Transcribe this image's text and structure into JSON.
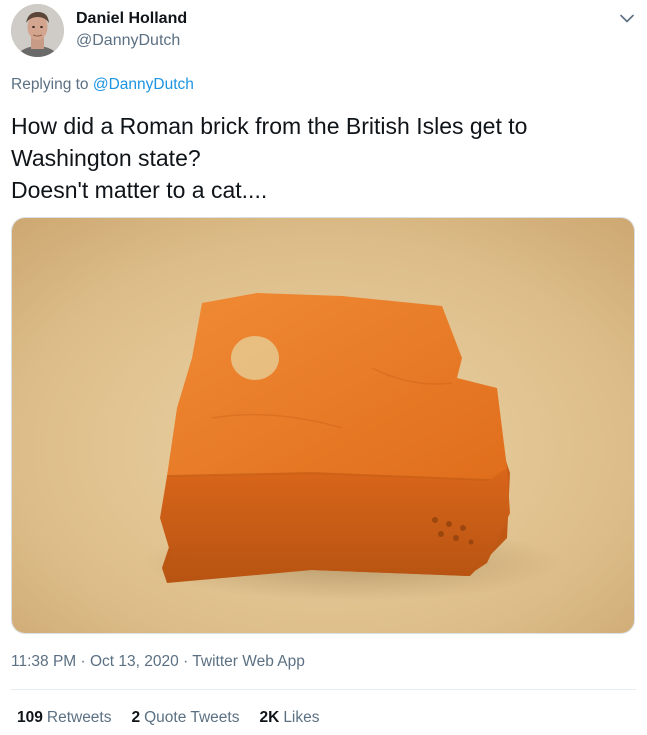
{
  "author": {
    "name": "Daniel Holland",
    "handle": "@DannyDutch"
  },
  "reply": {
    "prefix": "Replying to",
    "mention": "@DannyDutch"
  },
  "tweet": {
    "lines": [
      "How did a Roman brick from the British Isles get to",
      "Washington state?",
      "Doesn't matter to a cat...."
    ]
  },
  "meta": {
    "time": "11:38 PM",
    "separator1": "·",
    "date": "Oct 13, 2020",
    "separator2": "·",
    "source": "Twitter Web App"
  },
  "stats": {
    "retweets_count": "109",
    "retweets_label": "Retweets",
    "quotes_count": "2",
    "quotes_label": "Quote Tweets",
    "likes_count": "2K",
    "likes_label": "Likes"
  },
  "colors": {
    "link": "#1b95e0",
    "secondary_text": "#5b7083",
    "primary_text": "#0f1419",
    "brick": "#e77b2c"
  }
}
